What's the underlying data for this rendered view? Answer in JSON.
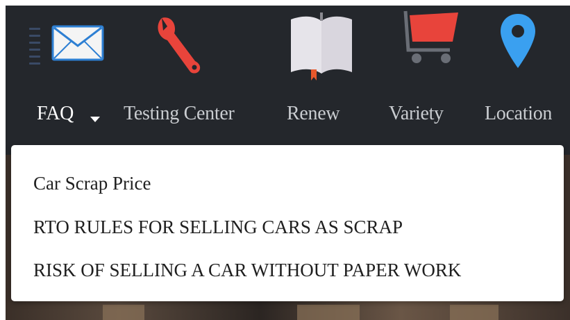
{
  "nav": {
    "items": [
      {
        "label": "FAQ",
        "icon": "envelope-icon",
        "active": true
      },
      {
        "label": "Testing Center",
        "icon": "wrench-icon"
      },
      {
        "label": "Renew",
        "icon": "book-icon"
      },
      {
        "label": "Variety",
        "icon": "cart-icon"
      },
      {
        "label": "Location",
        "icon": "location-pin-icon"
      }
    ]
  },
  "dropdown": {
    "items": [
      "Car Scrap Price",
      "RTO RULES FOR SELLING CARS AS SCRAP",
      "RISK OF SELLING A CAR WITHOUT PAPER WORK"
    ]
  },
  "colors": {
    "navbar_bg": "#24272c",
    "nav_text": "#c9ccd0",
    "nav_text_active": "#ffffff",
    "wrench": "#e8443b",
    "cart": "#e8443b",
    "pin": "#3aa0f0",
    "dropdown_bg": "#ffffff"
  }
}
